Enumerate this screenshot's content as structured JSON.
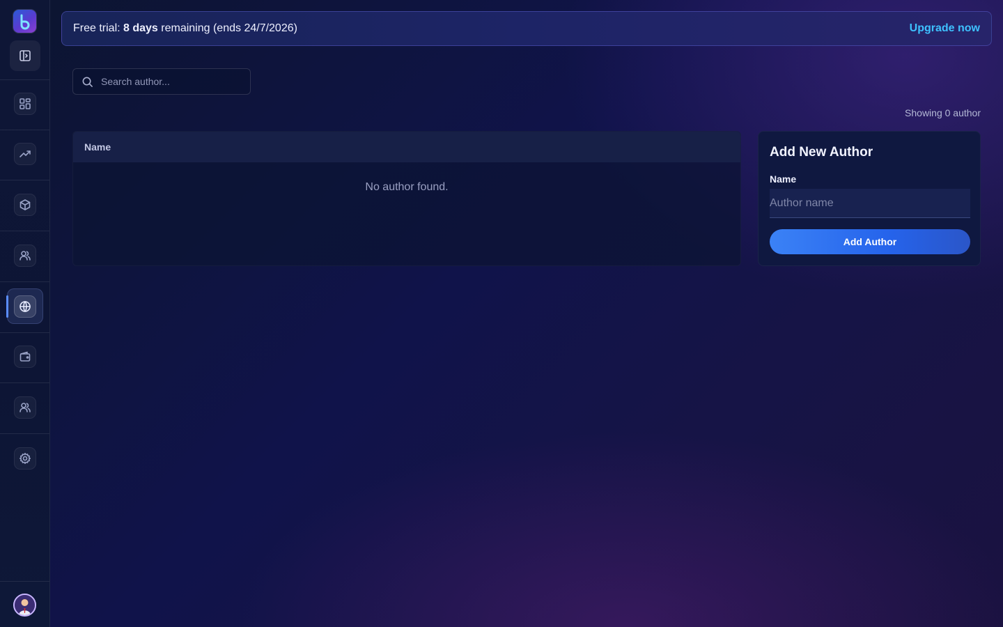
{
  "banner": {
    "prefix": "Free trial: ",
    "days": "8 days",
    "suffix": " remaining (ends 24/7/2026)",
    "upgrade_label": "Upgrade now"
  },
  "search": {
    "placeholder": "Search author..."
  },
  "results": {
    "showing": "Showing 0 author"
  },
  "table": {
    "columns": [
      "Name"
    ],
    "rows": [],
    "empty_text": "No author found."
  },
  "add_author": {
    "title": "Add New Author",
    "name_label": "Name",
    "name_placeholder": "Author name",
    "button_label": "Add Author"
  },
  "sidebar": {
    "items": [
      {
        "icon": "dashboard-icon"
      },
      {
        "icon": "trending-up-icon"
      },
      {
        "icon": "package-icon"
      },
      {
        "icon": "users-icon"
      },
      {
        "icon": "globe-icon",
        "active": true
      },
      {
        "icon": "wallet-icon"
      },
      {
        "icon": "team-icon"
      },
      {
        "icon": "gear-icon"
      }
    ]
  },
  "colors": {
    "accent": "#3b82f6",
    "link": "#3ec1ff",
    "background": "#10134a"
  }
}
